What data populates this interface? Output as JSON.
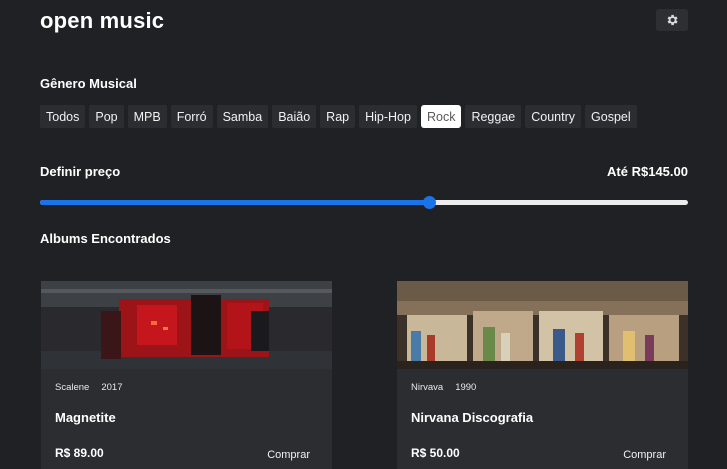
{
  "app": {
    "title": "open music"
  },
  "header": {
    "settings_icon": "gear-icon"
  },
  "genres": {
    "heading": "Gênero Musical",
    "items": [
      {
        "label": "Todos",
        "active": false
      },
      {
        "label": "Pop",
        "active": false
      },
      {
        "label": "MPB",
        "active": false
      },
      {
        "label": "Forró",
        "active": false
      },
      {
        "label": "Samba",
        "active": false
      },
      {
        "label": "Baião",
        "active": false
      },
      {
        "label": "Rap",
        "active": false
      },
      {
        "label": "Hip-Hop",
        "active": false
      },
      {
        "label": "Rock",
        "active": true
      },
      {
        "label": "Reggae",
        "active": false
      },
      {
        "label": "Country",
        "active": false
      },
      {
        "label": "Gospel",
        "active": false
      }
    ]
  },
  "price": {
    "label": "Definir preço",
    "value_text": "Até R$145.00",
    "slider_fraction": 0.6
  },
  "albums": {
    "heading": "Albums Encontrados",
    "items": [
      {
        "band": "Scalene",
        "year": "2017",
        "title": "Magnetite",
        "price": "R$ 89.00",
        "buy_label": "Comprar",
        "cover": "red-abstract-cover-image"
      },
      {
        "band": "Nirvava",
        "year": "1990",
        "title": "Nirvana Discografia",
        "price": "R$ 50.00",
        "buy_label": "Comprar",
        "cover": "record-store-bins-image"
      }
    ]
  },
  "colors": {
    "background": "#202124",
    "card": "#2b2d31",
    "accent": "#1a73e8"
  }
}
